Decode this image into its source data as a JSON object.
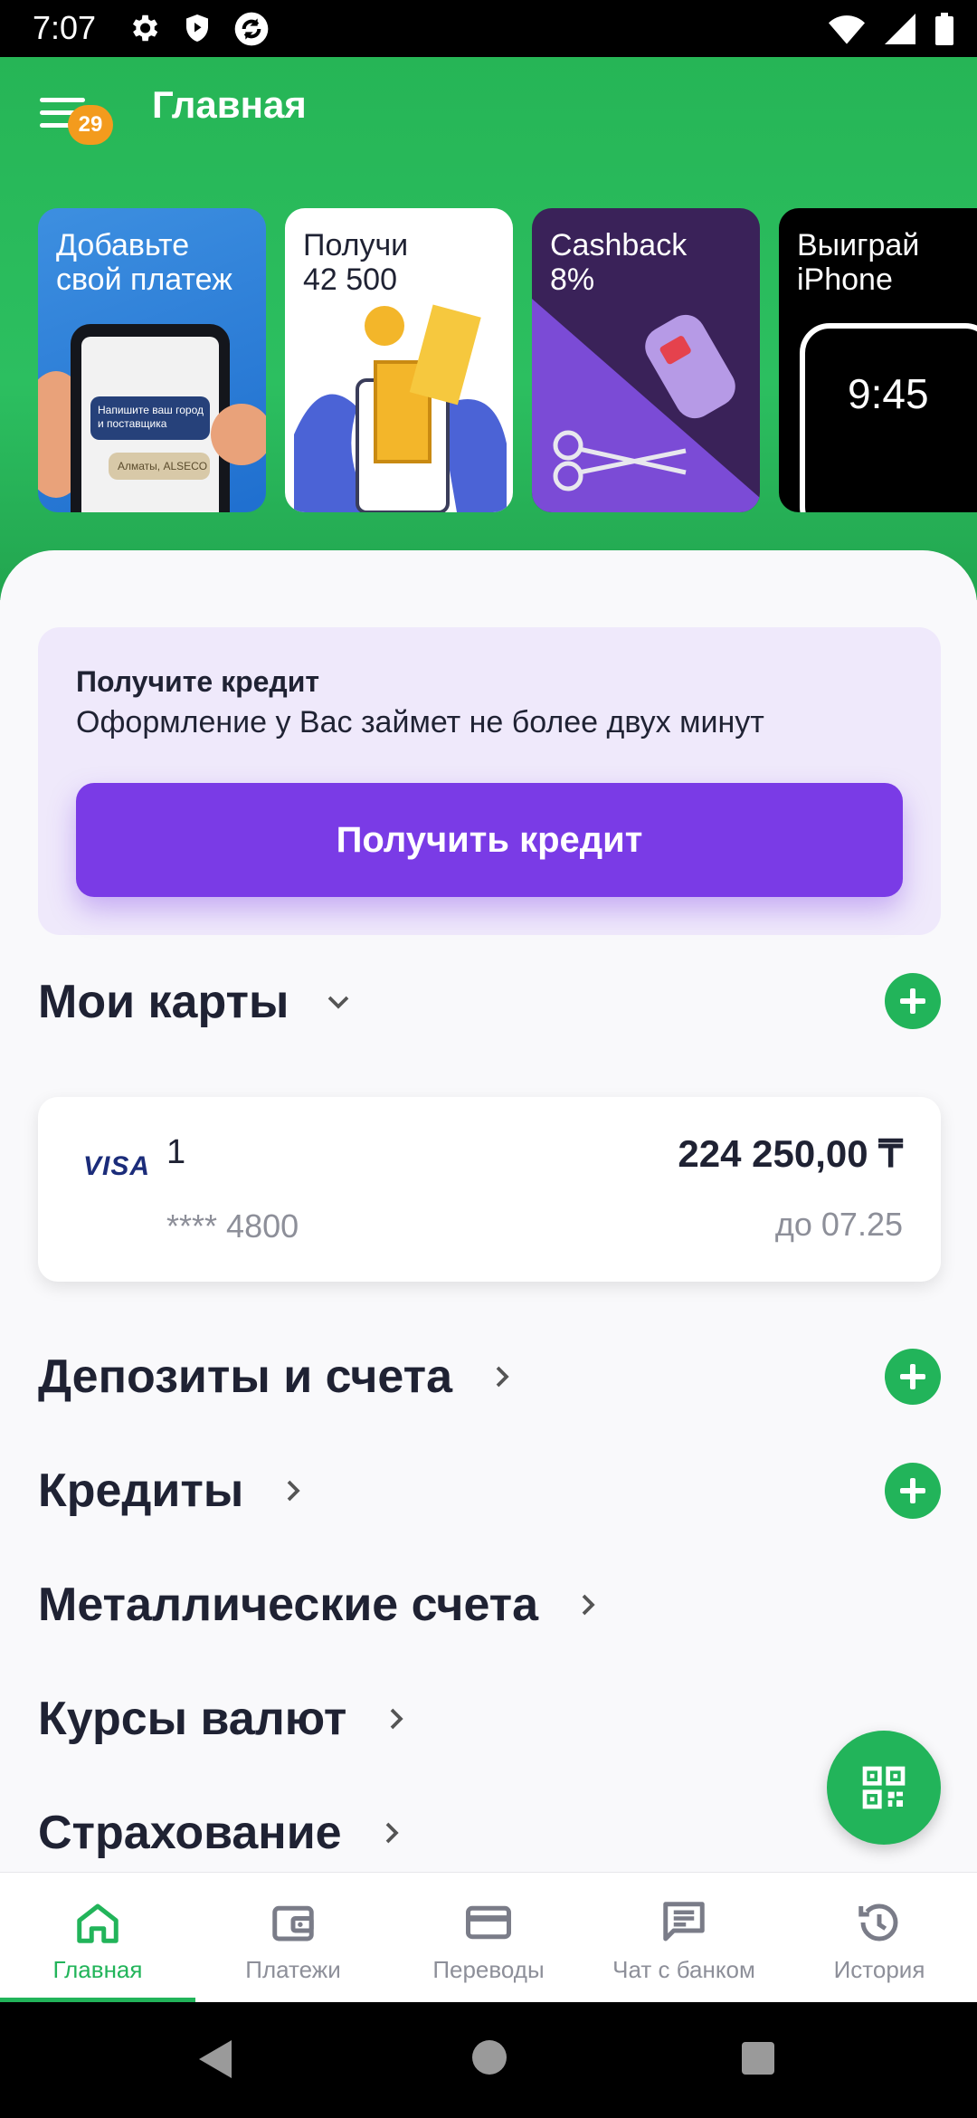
{
  "status_bar": {
    "time": "7:07"
  },
  "header": {
    "title": "Главная",
    "notification_count": "29"
  },
  "promos": [
    {
      "line1": "Добавьте",
      "line2": "свой платеж",
      "illustration_text": [
        "Напишите ваш город",
        "и поставщика",
        "Алматы, ALSECO"
      ]
    },
    {
      "line1": "Получи",
      "line2": "42 500"
    },
    {
      "line1": "Cashback",
      "line2": "8%"
    },
    {
      "line1": "Выиграй",
      "line2": "iPhone",
      "screen_time": "9:45"
    }
  ],
  "credit_offer": {
    "title": "Получите кредит",
    "subtitle": "Оформление у Вас займет не более двух минут",
    "button_label": "Получить кредит"
  },
  "my_cards": {
    "title": "Мои карты",
    "cards": [
      {
        "brand": "VISA",
        "name": "1",
        "masked_number": "**** 4800",
        "balance": "224 250,00 ₸",
        "expiry": "до 07.25"
      }
    ]
  },
  "sections": [
    {
      "label": "Депозиты и счета",
      "has_add": true
    },
    {
      "label": "Кредиты",
      "has_add": true
    },
    {
      "label": "Металлические счета",
      "has_add": false
    },
    {
      "label": "Курсы валют",
      "has_add": false
    },
    {
      "label": "Страхование",
      "has_add": false
    }
  ],
  "bottom_nav": [
    {
      "label": "Главная",
      "icon": "home-icon",
      "active": true
    },
    {
      "label": "Платежи",
      "icon": "wallet-icon",
      "active": false
    },
    {
      "label": "Переводы",
      "icon": "card-icon",
      "active": false
    },
    {
      "label": "Чат с банком",
      "icon": "chat-icon",
      "active": false
    },
    {
      "label": "История",
      "icon": "history-icon",
      "active": false
    }
  ],
  "colors": {
    "brand_green": "#22b45a",
    "accent_purple": "#7a3be6",
    "badge_orange": "#f39b1d"
  }
}
